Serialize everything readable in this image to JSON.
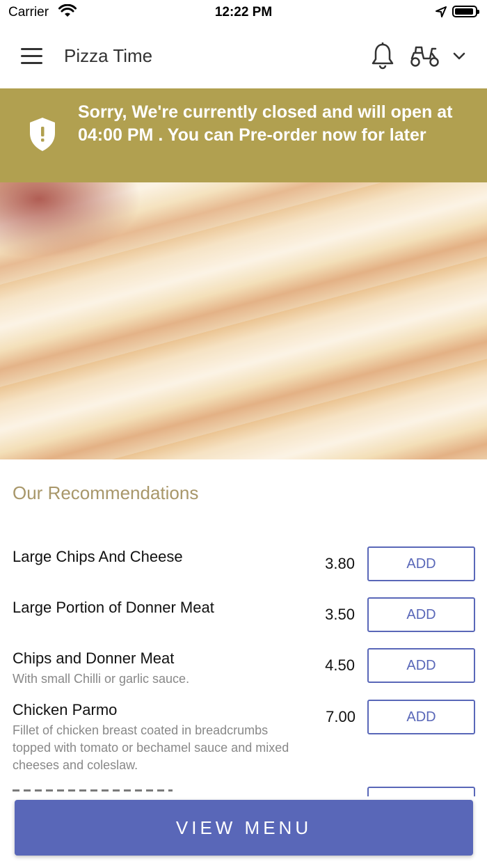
{
  "statusbar": {
    "carrier": "Carrier",
    "time": "12:22 PM"
  },
  "header": {
    "title": "Pizza Time"
  },
  "banner": {
    "text": "Sorry, We're currently closed and will open at 04:00 PM . You can Pre-order now for later"
  },
  "recommendations": {
    "heading": "Our Recommendations",
    "items": [
      {
        "name": "Large Chips And Cheese",
        "desc": "",
        "price": "3.80",
        "button": "ADD"
      },
      {
        "name": "Large Portion of Donner Meat",
        "desc": "",
        "price": "3.50",
        "button": "ADD"
      },
      {
        "name": "Chips and Donner Meat",
        "desc": "With small Chilli or garlic sauce.",
        "price": "4.50",
        "button": "ADD"
      },
      {
        "name": "Chicken Parmo",
        "desc": "Fillet of chicken breast coated in breadcrumbs topped with tomato or bechamel sauce and mixed cheeses and coleslaw.",
        "price": "7.00",
        "button": "ADD"
      }
    ]
  },
  "footer": {
    "view_menu": "VIEW MENU"
  },
  "colors": {
    "banner": "#b1a050",
    "accent": "#5967b8",
    "heading": "#a8976a"
  }
}
